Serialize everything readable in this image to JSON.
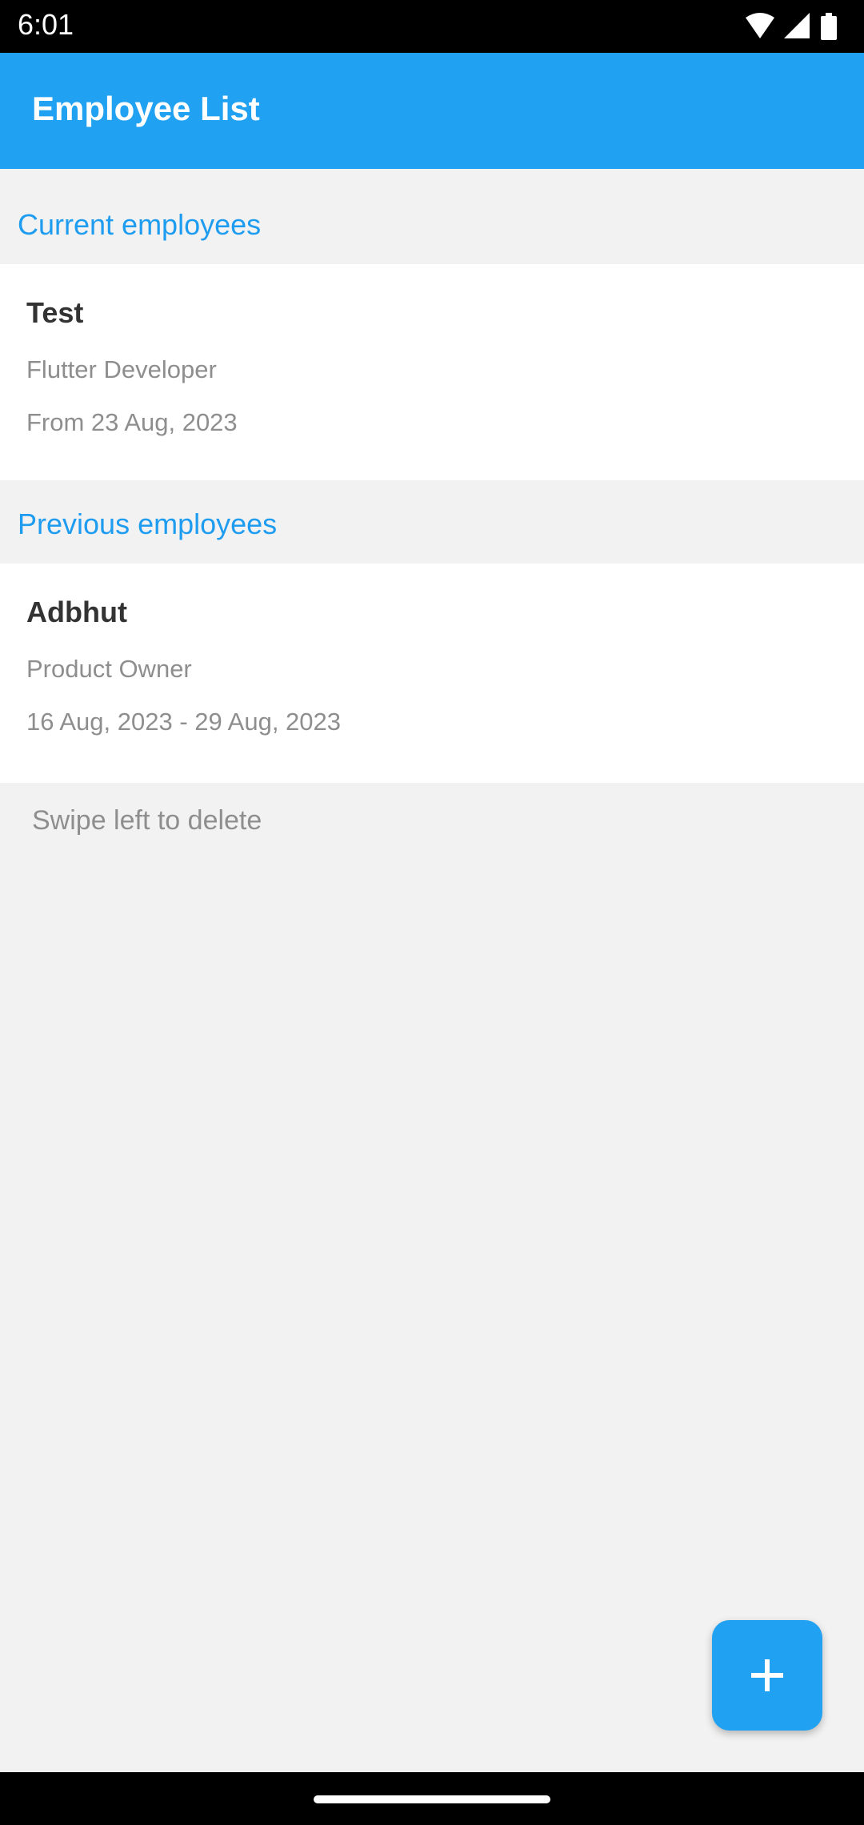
{
  "status_bar": {
    "time": "6:01",
    "icons": [
      "wifi-icon",
      "signal-icon",
      "battery-icon"
    ]
  },
  "app_bar": {
    "title": "Employee List"
  },
  "sections": {
    "current": {
      "title": "Current employees",
      "employees": [
        {
          "name": "Test",
          "role": "Flutter Developer",
          "dates": "From 23 Aug, 2023"
        }
      ]
    },
    "previous": {
      "title": "Previous employees",
      "employees": [
        {
          "name": "Adbhut",
          "role": "Product Owner",
          "dates": "16 Aug, 2023 - 29 Aug, 2023"
        }
      ]
    }
  },
  "hint": "Swipe left to delete",
  "fab": {
    "icon": "plus-icon"
  },
  "colors": {
    "primary": "#21a1f1",
    "section_title": "#1e9cf0",
    "background": "#f2f2f2"
  }
}
